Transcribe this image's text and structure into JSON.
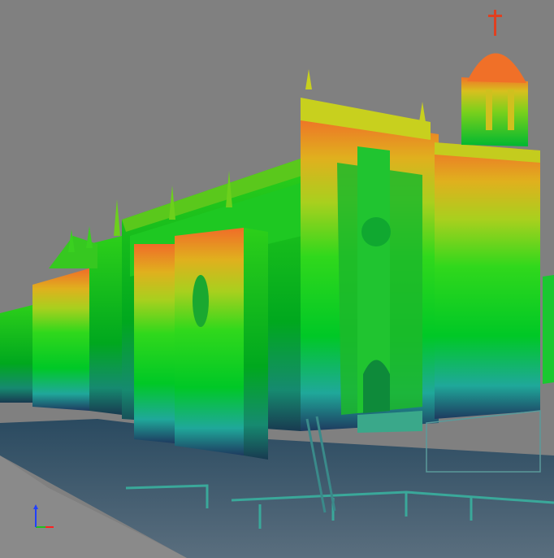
{
  "viewer": {
    "background_color": "#808080",
    "colormap": {
      "name": "height-ramp",
      "stops": [
        "#1e3a5f",
        "#1fa89a",
        "#00d21e",
        "#5bd81a",
        "#c8d21e",
        "#e6a01e",
        "#f06c28"
      ]
    },
    "axis_colors": {
      "x": "#ff2020",
      "y": "#20c020",
      "z": "#2040ff"
    }
  },
  "subject": {
    "description_icon": "cathedral-point-cloud-icon"
  }
}
